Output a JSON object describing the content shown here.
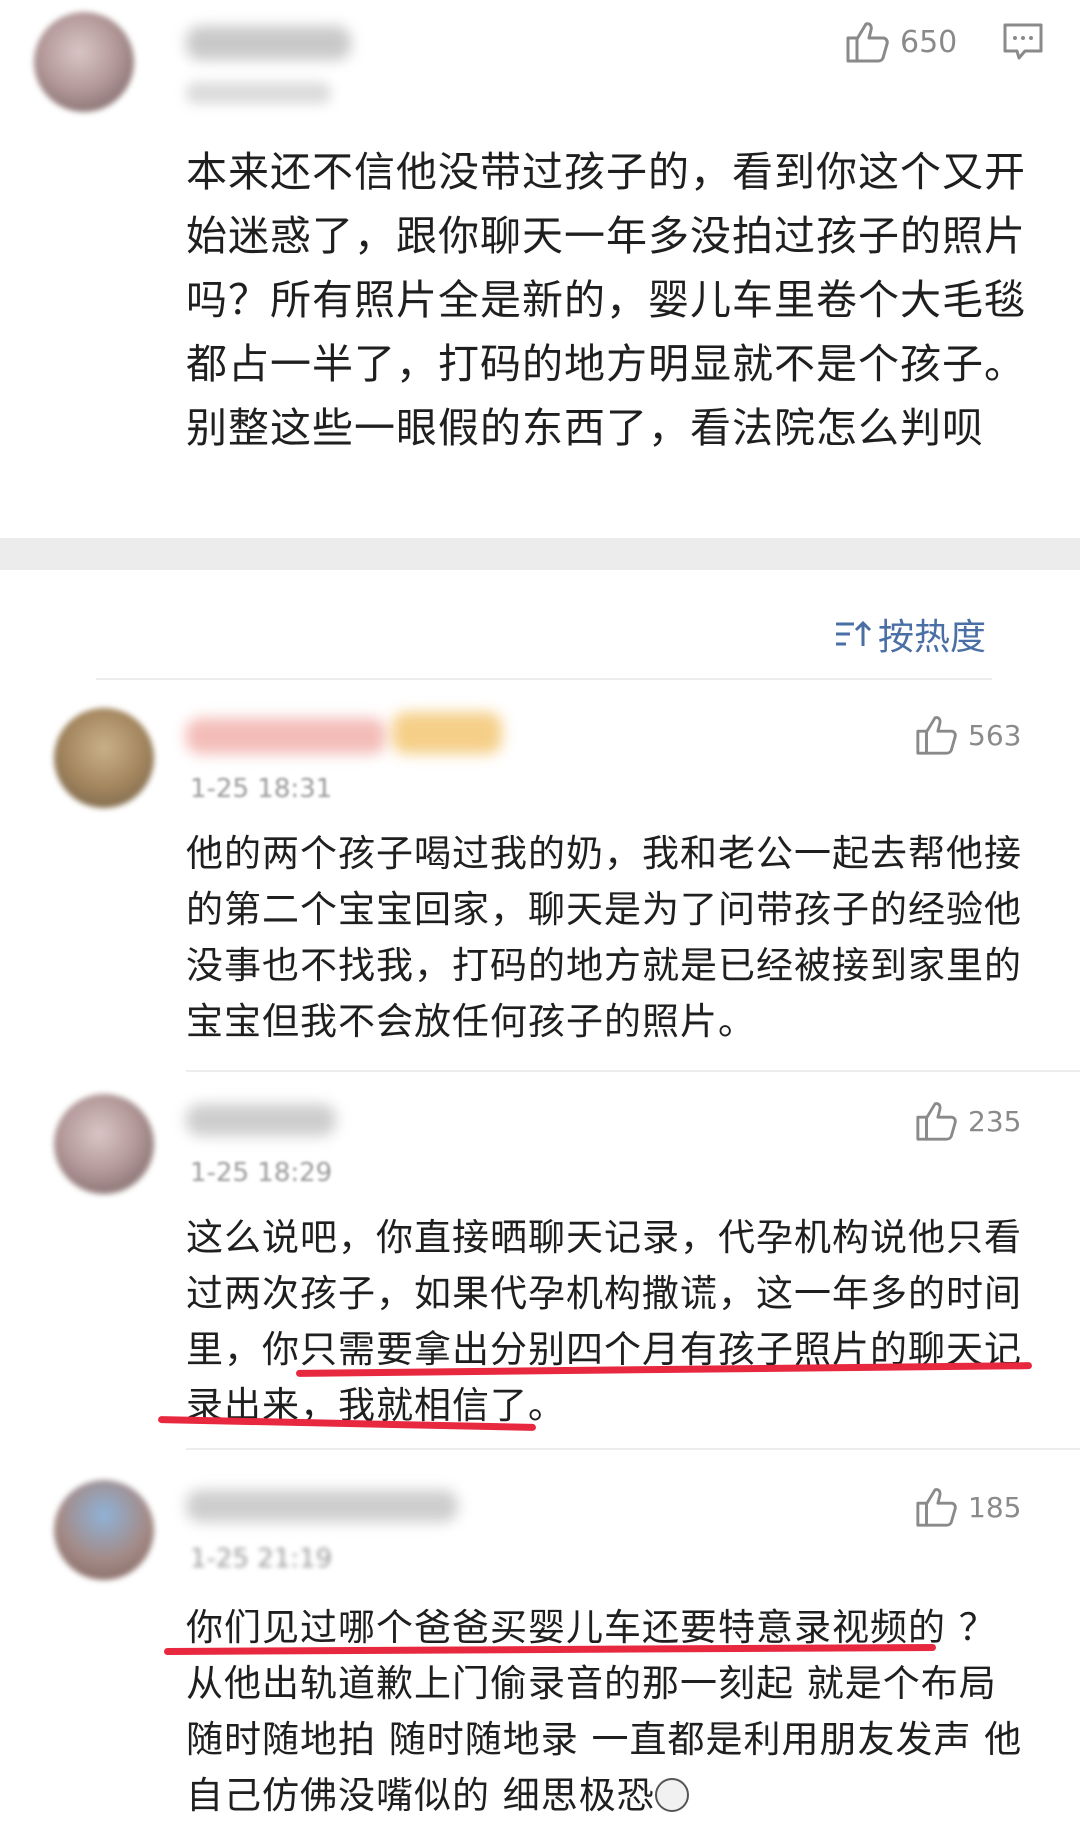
{
  "main_comment": {
    "like_count": "650",
    "text": "本来还不信他没带过孩子的，看到你这个又开始迷惑了，跟你聊天一年多没拍过孩子的照片吗？所有照片全是新的，婴儿车里卷个大毛毯都占一半了，打码的地方明显就不是个孩子。别整这些一眼假的东西了，看法院怎么判呗"
  },
  "sort": {
    "label": "按热度"
  },
  "replies": [
    {
      "time": "1-25 18:31",
      "like_count": "563",
      "text": "他的两个孩子喝过我的奶，我和老公一起去帮他接的第二个宝宝回家，聊天是为了问带孩子的经验他没事也不找我，打码的地方就是已经被接到家里的宝宝但我不会放任何孩子的照片。"
    },
    {
      "time": "1-25 18:29",
      "like_count": "235",
      "text": "这么说吧，你直接晒聊天记录，代孕机构说他只看过两次孩子，如果代孕机构撒谎，这一年多的时间里，你只需要拿出分别四个月有孩子照片的聊天记录出来，我就相信了。"
    },
    {
      "time": "1-25 21:19",
      "like_count": "185",
      "text": "你们见过哪个爸爸买婴儿车还要特意录视频的 ？从他出轨道歉上门偷录音的那一刻起 就是个布局 随时随地拍 随时随地录 一直都是利用朋友发声 他自己仿佛没嘴似的 细思极恐"
    }
  ],
  "colors": {
    "underline": "#e8283f",
    "sort_text": "#4a6fa5",
    "band": "#ececec"
  }
}
